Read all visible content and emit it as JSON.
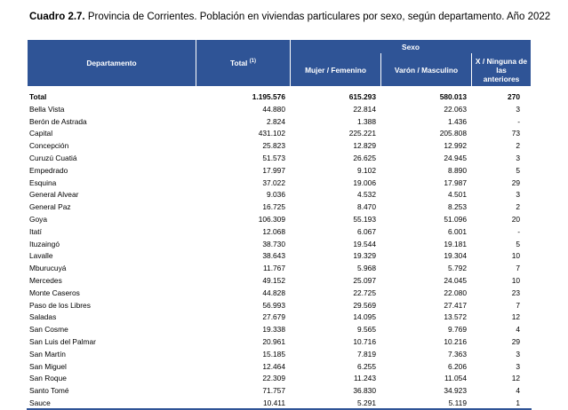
{
  "title": {
    "bold": "Cuadro 2.7.",
    "text": " Provincia de Corrientes. Población en viviendas particulares por sexo, según departamento. Año 2022"
  },
  "headers": {
    "departamento": "Departamento",
    "total": "Total",
    "total_note": "(1)",
    "sexo": "Sexo",
    "mujer": "Mujer / Femenino",
    "varon": "Varón / Masculino",
    "ninguna_line1": "X / Ninguna de las",
    "ninguna_line2": "anteriores"
  },
  "rows": [
    {
      "dep": "Total",
      "total": "1.195.576",
      "mujer": "615.293",
      "varon": "580.013",
      "x": "270"
    },
    {
      "dep": "Bella Vista",
      "total": "44.880",
      "mujer": "22.814",
      "varon": "22.063",
      "x": "3"
    },
    {
      "dep": "Berón de Astrada",
      "total": "2.824",
      "mujer": "1.388",
      "varon": "1.436",
      "x": "-"
    },
    {
      "dep": "Capital",
      "total": "431.102",
      "mujer": "225.221",
      "varon": "205.808",
      "x": "73"
    },
    {
      "dep": "Concepción",
      "total": "25.823",
      "mujer": "12.829",
      "varon": "12.992",
      "x": "2"
    },
    {
      "dep": "Curuzú Cuatiá",
      "total": "51.573",
      "mujer": "26.625",
      "varon": "24.945",
      "x": "3"
    },
    {
      "dep": "Empedrado",
      "total": "17.997",
      "mujer": "9.102",
      "varon": "8.890",
      "x": "5"
    },
    {
      "dep": "Esquina",
      "total": "37.022",
      "mujer": "19.006",
      "varon": "17.987",
      "x": "29"
    },
    {
      "dep": "General Alvear",
      "total": "9.036",
      "mujer": "4.532",
      "varon": "4.501",
      "x": "3"
    },
    {
      "dep": "General Paz",
      "total": "16.725",
      "mujer": "8.470",
      "varon": "8.253",
      "x": "2"
    },
    {
      "dep": "Goya",
      "total": "106.309",
      "mujer": "55.193",
      "varon": "51.096",
      "x": "20"
    },
    {
      "dep": "Itatí",
      "total": "12.068",
      "mujer": "6.067",
      "varon": "6.001",
      "x": "-"
    },
    {
      "dep": "Ituzaingó",
      "total": "38.730",
      "mujer": "19.544",
      "varon": "19.181",
      "x": "5"
    },
    {
      "dep": "Lavalle",
      "total": "38.643",
      "mujer": "19.329",
      "varon": "19.304",
      "x": "10"
    },
    {
      "dep": "Mburucuyá",
      "total": "11.767",
      "mujer": "5.968",
      "varon": "5.792",
      "x": "7"
    },
    {
      "dep": "Mercedes",
      "total": "49.152",
      "mujer": "25.097",
      "varon": "24.045",
      "x": "10"
    },
    {
      "dep": "Monte Caseros",
      "total": "44.828",
      "mujer": "22.725",
      "varon": "22.080",
      "x": "23"
    },
    {
      "dep": "Paso de los Libres",
      "total": "56.993",
      "mujer": "29.569",
      "varon": "27.417",
      "x": "7"
    },
    {
      "dep": "Saladas",
      "total": "27.679",
      "mujer": "14.095",
      "varon": "13.572",
      "x": "12"
    },
    {
      "dep": "San Cosme",
      "total": "19.338",
      "mujer": "9.565",
      "varon": "9.769",
      "x": "4"
    },
    {
      "dep": "San Luis del Palmar",
      "total": "20.961",
      "mujer": "10.716",
      "varon": "10.216",
      "x": "29"
    },
    {
      "dep": "San Martín",
      "total": "15.185",
      "mujer": "7.819",
      "varon": "7.363",
      "x": "3"
    },
    {
      "dep": "San Miguel",
      "total": "12.464",
      "mujer": "6.255",
      "varon": "6.206",
      "x": "3"
    },
    {
      "dep": "San Roque",
      "total": "22.309",
      "mujer": "11.243",
      "varon": "11.054",
      "x": "12"
    },
    {
      "dep": "Santo Tomé",
      "total": "71.757",
      "mujer": "36.830",
      "varon": "34.923",
      "x": "4"
    },
    {
      "dep": "Sauce",
      "total": "10.411",
      "mujer": "5.291",
      "varon": "5.119",
      "x": "1"
    }
  ]
}
